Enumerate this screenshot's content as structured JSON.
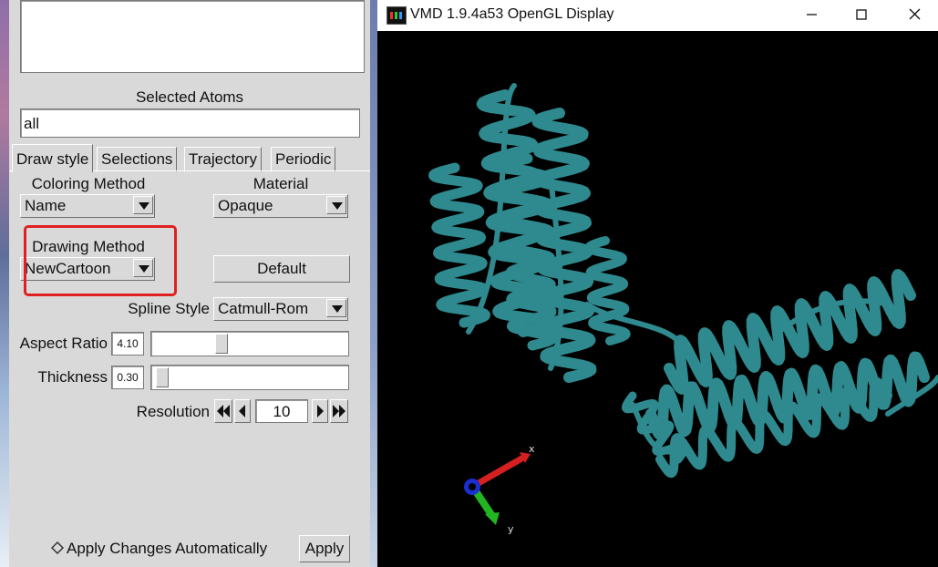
{
  "panel": {
    "selected_atoms_label": "Selected Atoms",
    "selection_value": "all",
    "tabs": [
      {
        "label": "Draw style",
        "active": true
      },
      {
        "label": "Selections",
        "active": false
      },
      {
        "label": "Trajectory",
        "active": false
      },
      {
        "label": "Periodic",
        "active": false
      }
    ],
    "coloring_method_label": "Coloring Method",
    "coloring_method_value": "Name",
    "material_label": "Material",
    "material_value": "Opaque",
    "drawing_method_label": "Drawing Method",
    "drawing_method_value": "NewCartoon",
    "default_button": "Default",
    "spline_style_label": "Spline Style",
    "spline_style_value": "Catmull-Rom",
    "aspect_ratio_label": "Aspect Ratio",
    "aspect_ratio_value": "4.10",
    "thickness_label": "Thickness",
    "thickness_value": "0.30",
    "resolution_label": "Resolution",
    "resolution_value": "10",
    "apply_auto_label": "Apply Changes Automatically",
    "apply_button": "Apply",
    "highlight_color": "#e02020"
  },
  "vmd": {
    "title": "VMD 1.9.4a53 OpenGL Display",
    "axis_x": "x",
    "axis_y": "y",
    "ribbon_color": "#2f8a8f",
    "background": "#000000"
  }
}
